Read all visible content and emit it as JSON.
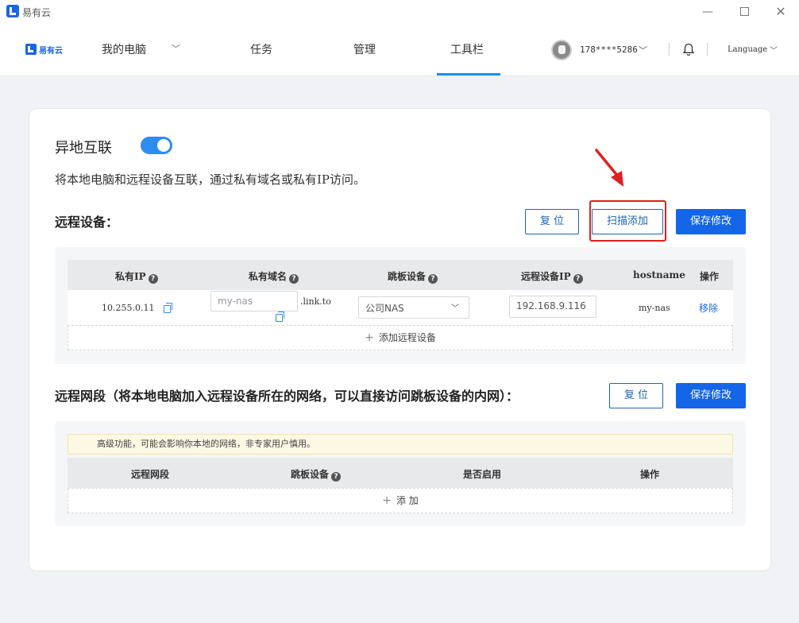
{
  "window": {
    "title": "易有云"
  },
  "nav": {
    "logo_text": "易有云",
    "my_pc": "我的电脑",
    "task": "任务",
    "manage": "管理",
    "toolbar": "工具栏",
    "user_phone": "178****5286",
    "language": "Language"
  },
  "section": {
    "title": "异地互联",
    "enabled": true,
    "description": "将本地电脑和远程设备互联，通过私有域名或私有IP访问。"
  },
  "remote_devices": {
    "title": "远程设备：",
    "reset_label": "复 位",
    "scan_add_label": "扫描添加",
    "save_label": "保存修改",
    "columns": {
      "private_ip": "私有IP",
      "private_domain": "私有域名",
      "jump_device": "跳板设备",
      "remote_ip": "远程设备IP",
      "hostname": "hostname",
      "action": "操作"
    },
    "rows": [
      {
        "private_ip": "10.255.0.11",
        "domain_placeholder": "my-nas",
        "domain_suffix": ".link.to",
        "jump_device": "公司NAS",
        "remote_ip": "192.168.9.116",
        "hostname": "my-nas",
        "action": "移除"
      }
    ],
    "add_label": "添加远程设备"
  },
  "remote_segments": {
    "title": "远程网段（将本地电脑加入远程设备所在的网络，可以直接访问跳板设备的内网）：",
    "reset_label": "复 位",
    "save_label": "保存修改",
    "warning": "高级功能，可能会影响你本地的网络，非专家用户慎用。",
    "columns": {
      "segment": "远程网段",
      "jump_device": "跳板设备",
      "enabled": "是否启用",
      "action": "操作"
    },
    "add_label": "添 加"
  },
  "colors": {
    "accent": "#1465e8",
    "highlight": "#e02020"
  }
}
